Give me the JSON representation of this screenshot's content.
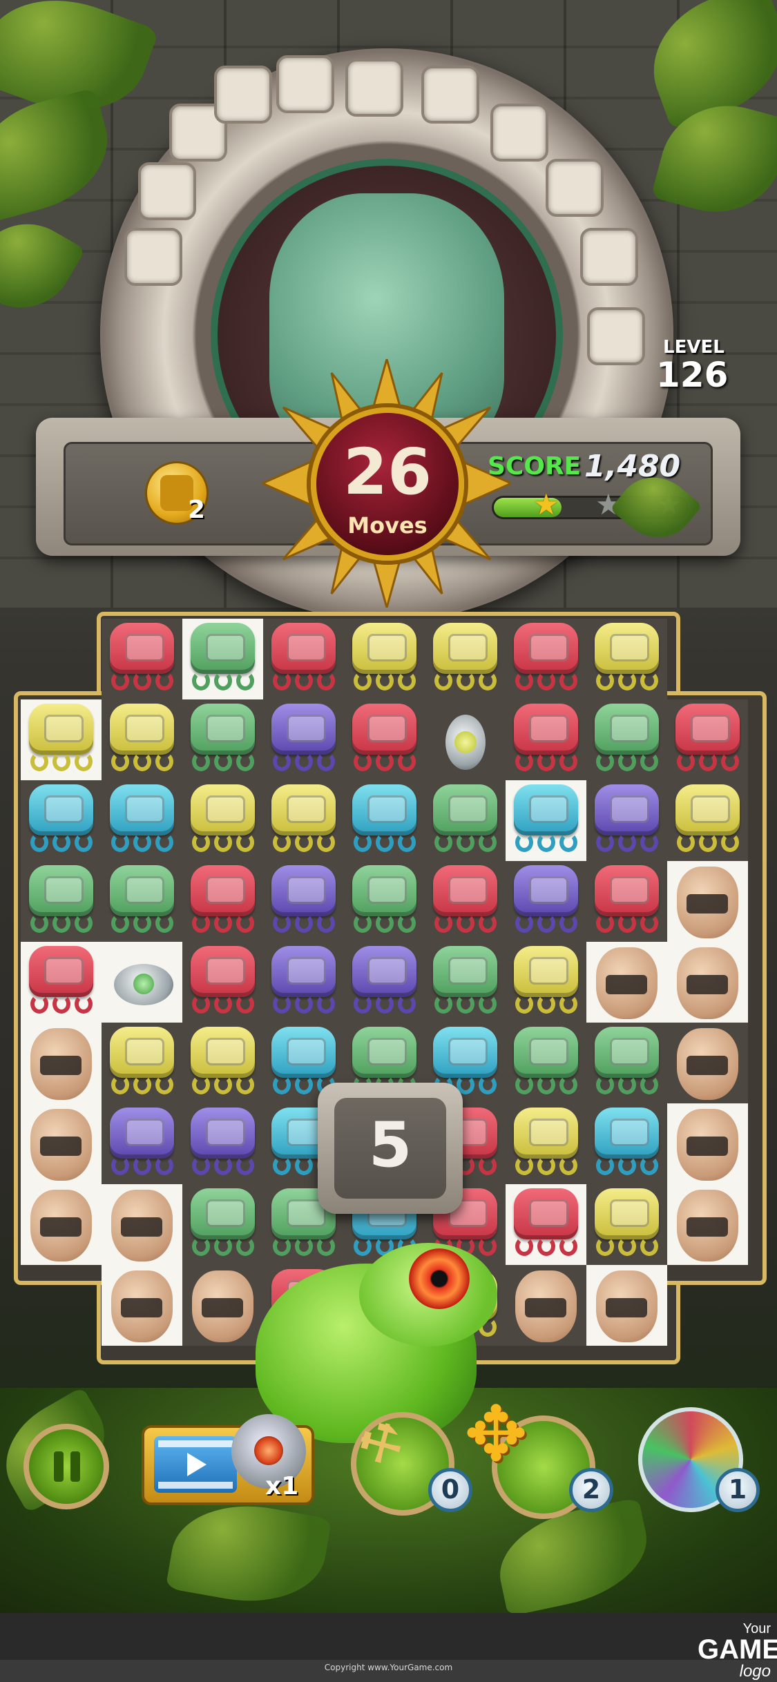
{
  "hud": {
    "level_label": "LEVEL",
    "level_value": "126",
    "moves_value": "26",
    "moves_label": "Moves",
    "score_label": "SCORE",
    "score_value": "1,480",
    "score_progress": 0.35,
    "stars_earned": 1,
    "stars_total": 3,
    "coin_count": "2"
  },
  "board": {
    "rows": [
      [
        "-",
        "red",
        "green",
        "red",
        "yellow",
        "yellow",
        "red",
        "yellow",
        "-"
      ],
      [
        "yellow",
        "yellow",
        "green",
        "purple",
        "red",
        "bomb",
        "red",
        "green",
        "red"
      ],
      [
        "blue",
        "blue",
        "yellow",
        "yellow",
        "blue",
        "green",
        "blue",
        "purple",
        "yellow"
      ],
      [
        "green",
        "green",
        "red",
        "purple",
        "green",
        "red",
        "purple",
        "red",
        "vase"
      ],
      [
        "red",
        "bombh",
        "red",
        "purple",
        "purple",
        "green",
        "yellow",
        "vase",
        "vase"
      ],
      [
        "vase",
        "yellow",
        "yellow",
        "blue",
        "green",
        "blue",
        "green",
        "green",
        "vase"
      ],
      [
        "vase",
        "purple",
        "purple",
        "blue",
        "blue",
        "red",
        "yellow",
        "blue",
        "vase"
      ],
      [
        "vase",
        "vase",
        "green",
        "green",
        "blue",
        "red",
        "red",
        "yellow",
        "vase"
      ],
      [
        "-",
        "vase",
        "vase",
        "red",
        "red",
        "yellow",
        "vase",
        "vase",
        "-"
      ]
    ],
    "light_cells": [
      [
        0,
        2
      ],
      [
        1,
        0
      ],
      [
        2,
        6
      ],
      [
        3,
        8
      ],
      [
        4,
        0
      ],
      [
        4,
        1
      ],
      [
        4,
        7
      ],
      [
        4,
        8
      ],
      [
        5,
        0
      ],
      [
        6,
        0
      ],
      [
        6,
        8
      ],
      [
        7,
        0
      ],
      [
        7,
        1
      ],
      [
        7,
        6
      ],
      [
        7,
        8
      ],
      [
        8,
        1
      ],
      [
        8,
        7
      ]
    ],
    "countdown": "5"
  },
  "boosters": {
    "video_qty": "x1",
    "hammer_count": "0",
    "move_count": "2",
    "orb_count": "1"
  },
  "footer": {
    "copyright": "Copyright www.YourGame.com",
    "logo_line1": "Your",
    "logo_line2": "GAME",
    "logo_line3": "logo"
  },
  "colors": {
    "score_green": "#54e84a",
    "moves_red": "#a8243a",
    "gold": "#d9a21c"
  }
}
